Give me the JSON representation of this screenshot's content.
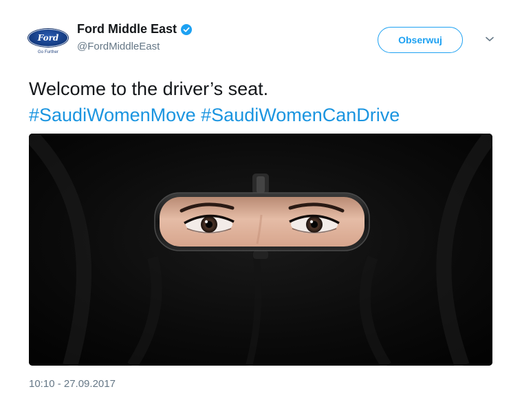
{
  "account": {
    "avatar_logo_text": "Ford",
    "avatar_tagline": "Go Further",
    "display_name": "Ford Middle East",
    "handle": "@FordMiddleEast",
    "verified": true
  },
  "actions": {
    "follow_label": "Obserwuj",
    "menu_icon": "chevron-down-icon"
  },
  "tweet": {
    "text": "Welcome to the driver’s seat.",
    "hashtags": [
      "#SaudiWomenMove",
      "#SaudiWomenCanDrive"
    ],
    "timestamp": "10:10 - 27.09.2017"
  },
  "media": {
    "icon": "mirror-eyes-image"
  },
  "colors": {
    "link": "#1b95e0",
    "follow": "#1da1f2",
    "text": "#14171a",
    "secondary": "#657786"
  }
}
